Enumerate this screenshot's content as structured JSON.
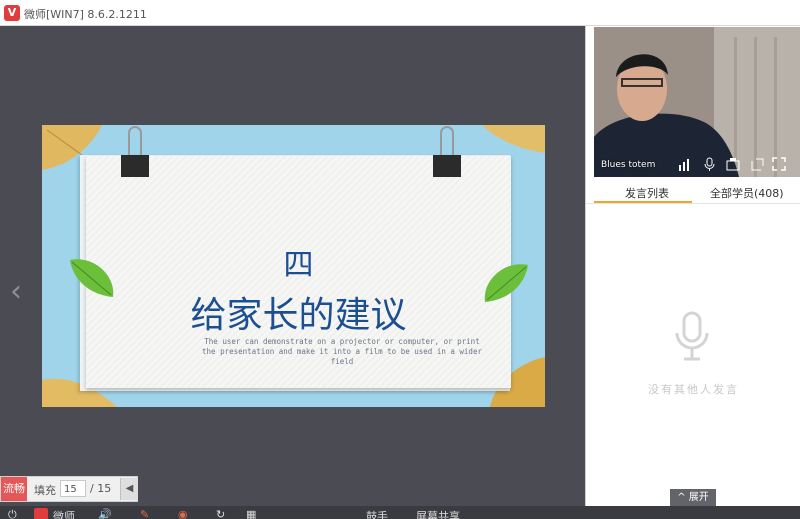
{
  "titlebar": {
    "logo": "V",
    "title": "微师[WIN7] 8.6.2.1211"
  },
  "stage": {
    "prev_icon": "chevron-left-icon"
  },
  "slide": {
    "number": "四",
    "title": "给家长的建议",
    "body": "The user can demonstrate on a projector or computer, or print the presentation and make it into a film to be used in a wider field"
  },
  "pager": {
    "fluent_label": "流畅",
    "fill_label": "填充",
    "current_page": "15",
    "total_pages": "/ 15",
    "collapse_icon": "triangle-left-icon"
  },
  "video": {
    "name": "Blues totem"
  },
  "tabs": [
    {
      "label": "发言列表",
      "active": true
    },
    {
      "label": "全部学员(408)",
      "active": false
    }
  ],
  "empty_state": {
    "text": "没有其他人发言"
  },
  "expand_label": "展开",
  "bottombar": {
    "brand": "微师",
    "item1": "鼓手",
    "item2": "屏幕共享"
  }
}
